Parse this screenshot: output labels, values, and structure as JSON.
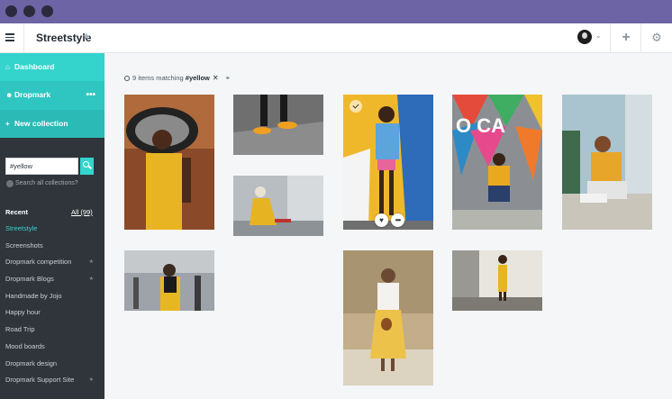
{
  "app": {
    "collection_title": "Streetstyle"
  },
  "sidebar": {
    "nav": [
      {
        "label": "Dashboard",
        "icon": "home-icon"
      },
      {
        "label": "Dropmark",
        "icon": "team-icon"
      },
      {
        "label": "New collection",
        "icon": "plus-icon"
      }
    ],
    "more_glyph": "•••",
    "search": {
      "value": "#yellow",
      "search_all_label": "Search all collections?"
    },
    "recent": {
      "heading": "Recent",
      "all_label": "All (99)",
      "items": [
        {
          "label": "Streetstyle",
          "active": true,
          "starred": false
        },
        {
          "label": "Screenshots",
          "active": false,
          "starred": false
        },
        {
          "label": "Dropmark competition",
          "active": false,
          "starred": true
        },
        {
          "label": "Dropmark Blogs",
          "active": false,
          "starred": true
        },
        {
          "label": "Handmade by Jojo",
          "active": false,
          "starred": false
        },
        {
          "label": "Happy hour",
          "active": false,
          "starred": false
        },
        {
          "label": "Road Trip",
          "active": false,
          "starred": false
        },
        {
          "label": "Mood boards",
          "active": false,
          "starred": false
        },
        {
          "label": "Dropmark design",
          "active": false,
          "starred": false
        },
        {
          "label": "Dropmark Support Site",
          "active": false,
          "starred": true
        }
      ]
    }
  },
  "filter": {
    "prefix": "9 items matching",
    "tag": "#yellow"
  },
  "colors": {
    "chrome": "#6c64a4",
    "accent": "#34d4cd",
    "sidebar_bg": "#2f353b",
    "main_bg": "#f4f6f8"
  }
}
